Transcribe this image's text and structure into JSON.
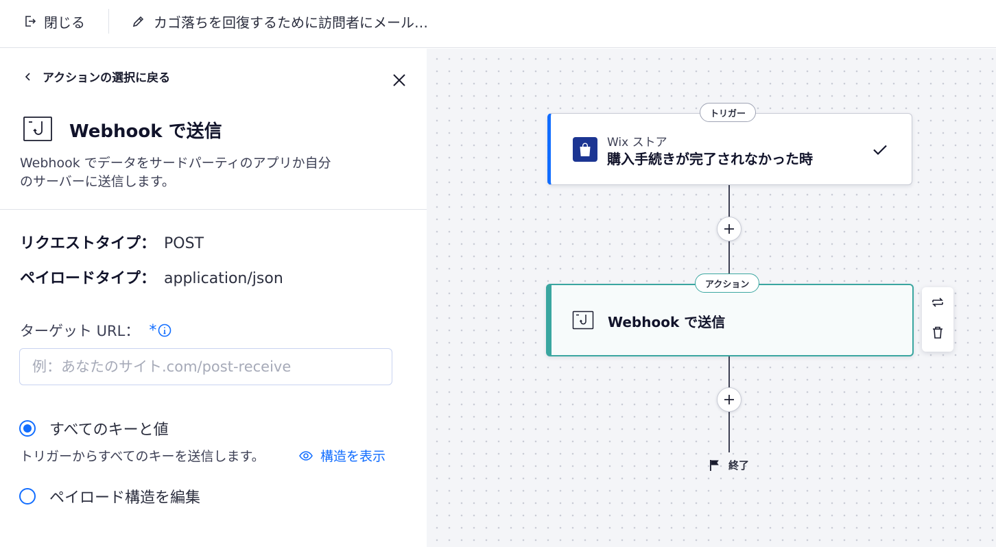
{
  "topbar": {
    "close_label": "閉じる",
    "automation_title": "カゴ落ちを回復するために訪問者にメール…"
  },
  "panel": {
    "back_label": "アクションの選択に戻る",
    "title": "Webhook で送信",
    "description_line1": "Webhook でデータをサードパーティのアプリか自分",
    "description_line2": "のサーバーに送信します。",
    "request_type_key": "リクエストタイプ：",
    "request_type_value": "POST",
    "payload_type_key": "ペイロードタイプ：",
    "payload_type_value": "application/json",
    "target_url_label": "ターゲット URL：",
    "required_mark": "*",
    "target_url_value": "",
    "target_url_placeholder": "例：あなたのサイト.com/post-receive",
    "radio_all_label": "すべてのキーと値",
    "radio_all_selected": true,
    "radio_all_hint": "トリガーからすべてのキーを送信します。",
    "show_structure_label": "構造を表示",
    "radio_edit_label": "ペイロード構造を編集",
    "radio_edit_selected": false
  },
  "canvas": {
    "trigger_pill": "トリガー",
    "trigger_app": "Wix ストア",
    "trigger_name": "購入手続きが完了されなかった時",
    "action_pill": "アクション",
    "action_name": "Webhook で送信",
    "end_label": "終了"
  },
  "colors": {
    "accent": "#116dff",
    "trigger_border": "#116dff",
    "action_border": "#3aa6a0",
    "store_icon_bg": "#1c3592"
  },
  "icons": {
    "close": "exit-icon",
    "edit": "pencil-icon",
    "back": "chevron-left-icon",
    "panel_close": "x-icon",
    "webhook": "webhook-icon",
    "info": "info-icon",
    "eye": "eye-icon",
    "store": "shopping-bag-icon",
    "check": "check-icon",
    "replace": "replace-icon",
    "delete": "trash-icon",
    "add": "plus-icon",
    "end": "flag-icon"
  }
}
